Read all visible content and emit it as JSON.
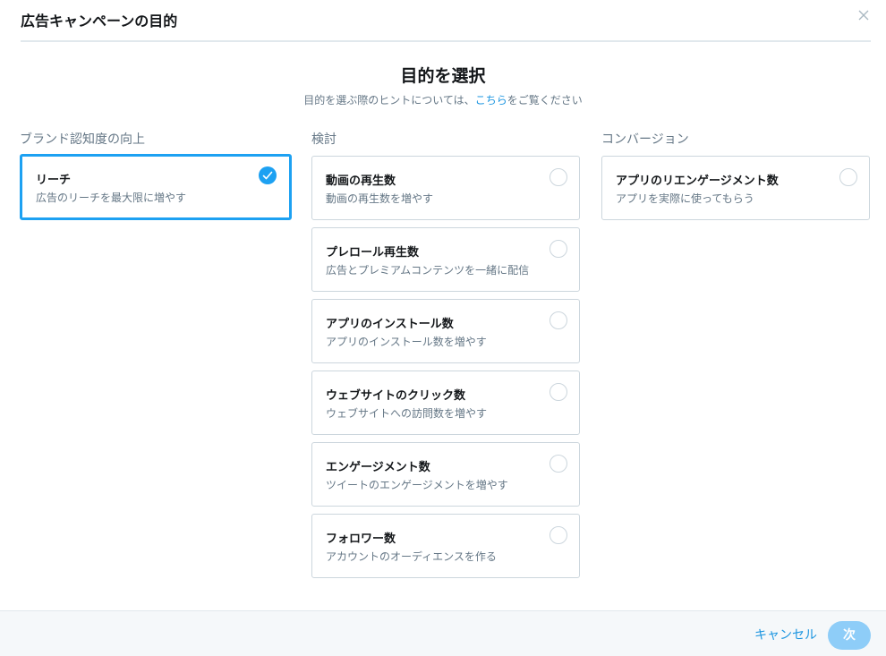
{
  "header": {
    "title": "広告キャンペーンの目的"
  },
  "intro": {
    "title": "目的を選択",
    "hint_prefix": "目的を選ぶ際のヒントについては、",
    "hint_link": "こちら",
    "hint_suffix": "をご覧ください"
  },
  "columns": [
    {
      "title": "ブランド認知度の向上",
      "cards": [
        {
          "title": "リーチ",
          "desc": "広告のリーチを最大限に増やす",
          "selected": true
        }
      ]
    },
    {
      "title": "検討",
      "cards": [
        {
          "title": "動画の再生数",
          "desc": "動画の再生数を増やす",
          "selected": false
        },
        {
          "title": "プレロール再生数",
          "desc": "広告とプレミアムコンテンツを一緒に配信",
          "selected": false
        },
        {
          "title": "アプリのインストール数",
          "desc": "アプリのインストール数を増やす",
          "selected": false
        },
        {
          "title": "ウェブサイトのクリック数",
          "desc": "ウェブサイトへの訪問数を増やす",
          "selected": false
        },
        {
          "title": "エンゲージメント数",
          "desc": "ツイートのエンゲージメントを増やす",
          "selected": false
        },
        {
          "title": "フォロワー数",
          "desc": "アカウントのオーディエンスを作る",
          "selected": false
        }
      ]
    },
    {
      "title": "コンバージョン",
      "cards": [
        {
          "title": "アプリのリエンゲージメント数",
          "desc": "アプリを実際に使ってもらう",
          "selected": false
        }
      ]
    }
  ],
  "footer": {
    "cancel_label": "キャンセル",
    "next_label": "次"
  },
  "colors": {
    "accent": "#1da1f2",
    "link": "#1b95e0",
    "next_disabled": "#8ecdf8"
  }
}
